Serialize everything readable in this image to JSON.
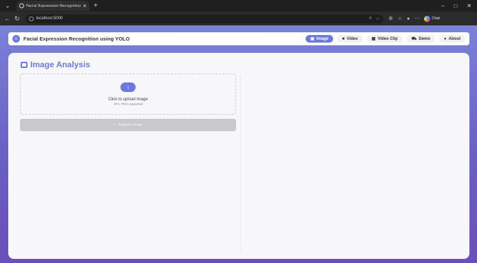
{
  "browser": {
    "tab_title": "Facial Expression Recognition usin",
    "url": "localhost:5000",
    "copilot_label": "Chat",
    "window_controls": [
      "–",
      "□",
      "✕"
    ]
  },
  "app": {
    "brand_title": "Facial Expression Recognition using YOLO",
    "nav": [
      {
        "label": "Image",
        "icon": "image-icon",
        "active": true
      },
      {
        "label": "Video",
        "icon": "video-icon",
        "active": false
      },
      {
        "label": "Video Clip",
        "icon": "film-icon",
        "active": false
      },
      {
        "label": "Demo",
        "icon": "cart-icon",
        "active": false
      },
      {
        "label": "About",
        "icon": "info-icon",
        "active": false
      }
    ]
  },
  "image_analysis": {
    "title": "Image Analysis",
    "upload_prompt": "Click to upload image",
    "upload_hint": "JPG, PNG supported",
    "analyze_button": "Analyze Image"
  },
  "colors": {
    "accent": "#6c7ae0",
    "disabled_button": "#c9c9cc"
  }
}
